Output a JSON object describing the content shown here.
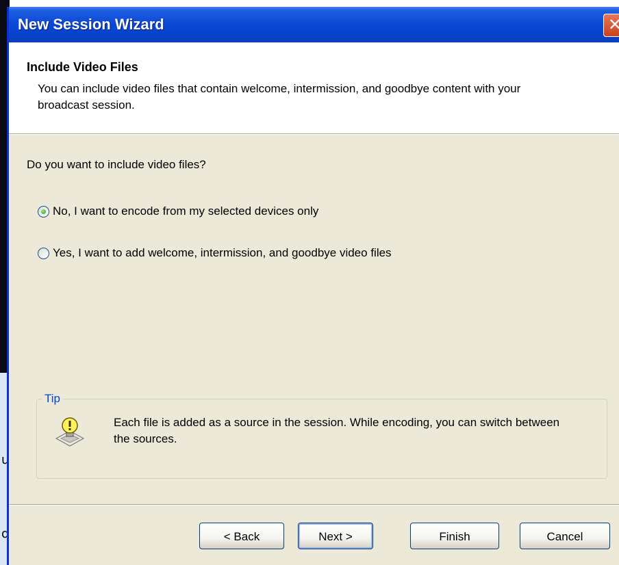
{
  "window": {
    "title": "New Session Wizard",
    "close_glyph": "✕"
  },
  "header": {
    "title": "Include Video Files",
    "description": "You can include video files that contain welcome, intermission, and goodbye content with your broadcast session."
  },
  "question": "Do you want to include video files?",
  "options": [
    {
      "label": "No, I want to encode from my selected devices only",
      "selected": true
    },
    {
      "label": "Yes, I want to add welcome, intermission, and goodbye video files",
      "selected": false
    }
  ],
  "tip": {
    "legend": "Tip",
    "icon": "lightbulb-tip-icon",
    "text": "Each file is added as a source in the session. While encoding, you can switch between the sources."
  },
  "buttons": {
    "back": "< Back",
    "next": "Next >",
    "finish": "Finish",
    "cancel": "Cancel"
  },
  "background_glyphs": [
    "u",
    "d"
  ],
  "colors": {
    "titlebar": "#0A48D6",
    "dialog_bg": "#ECE9D8",
    "tip_legend": "#0046D5",
    "close_button": "#D45531"
  }
}
